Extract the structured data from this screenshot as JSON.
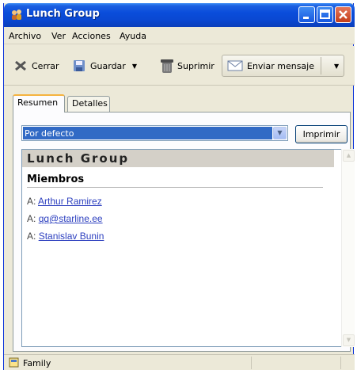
{
  "window": {
    "title": "Lunch Group"
  },
  "menu": [
    {
      "label": "Archivo"
    },
    {
      "label": "Ver"
    },
    {
      "label": "Acciones"
    },
    {
      "label": "Ayuda"
    }
  ],
  "toolbar": {
    "close_label": "Cerrar",
    "save_label": "Guardar",
    "delete_label": "Suprimir",
    "send_label": "Enviar mensaje"
  },
  "tabs": [
    {
      "label": "Resumen",
      "active": true
    },
    {
      "label": "Detalles",
      "active": false
    }
  ],
  "view": {
    "selected": "Por defecto",
    "print_label": "Imprimir"
  },
  "summary": {
    "group_name": "Lunch Group",
    "section_title": "Miembros",
    "member_prefix": "A:",
    "members": [
      "Arthur Ramirez",
      "qq@starline.ee",
      "Stanislav Bunin"
    ]
  },
  "status": {
    "text": "Family"
  },
  "colors": {
    "title_bar": "#0a48d2",
    "selection": "#316ac5",
    "link": "#2c3fbf"
  }
}
